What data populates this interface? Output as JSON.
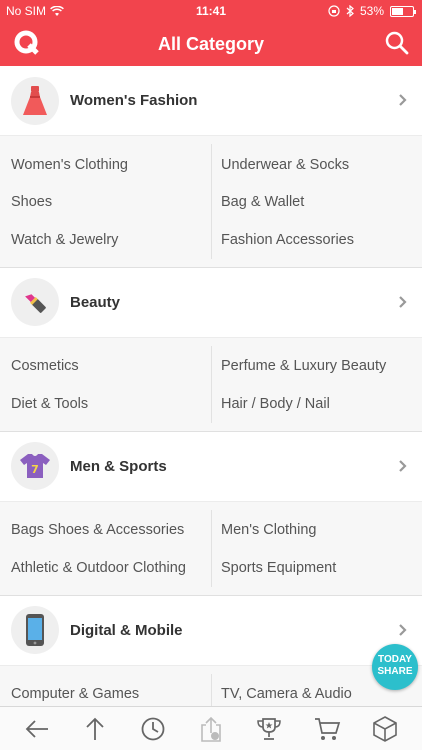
{
  "status_bar": {
    "carrier": "No SIM",
    "time": "11:41",
    "battery": "53%",
    "battery_level": 0.53
  },
  "header": {
    "title": "All Category"
  },
  "categories": [
    {
      "title": "Women's Fashion",
      "icon": "dress-icon",
      "subs": [
        [
          "Women's Clothing",
          "Underwear & Socks"
        ],
        [
          "Shoes",
          "Bag & Wallet"
        ],
        [
          "Watch & Jewelry",
          "Fashion Accessories"
        ]
      ]
    },
    {
      "title": "Beauty",
      "icon": "lipstick-icon",
      "subs": [
        [
          "Cosmetics",
          "Perfume & Luxury Beauty"
        ],
        [
          "Diet & Tools",
          "Hair / Body / Nail"
        ]
      ]
    },
    {
      "title": "Men & Sports",
      "icon": "jersey-icon",
      "subs": [
        [
          "Bags Shoes & Accessories",
          "Men's Clothing"
        ],
        [
          "Athletic & Outdoor Clothing",
          "Sports Equipment"
        ]
      ]
    },
    {
      "title": "Digital & Mobile",
      "icon": "smartphone-icon",
      "subs": [
        [
          "Computer & Games",
          "TV, Camera & Audio"
        ]
      ]
    }
  ],
  "floating": {
    "today_share_line1": "TODAY",
    "today_share_line2": "SHARE"
  },
  "bottom_bar": [
    "back-icon",
    "scroll-top-icon",
    "history-icon",
    "share-icon",
    "trophy-icon",
    "cart-icon",
    "box-icon"
  ],
  "colors": {
    "brand": "#f2444d",
    "accent": "#2cbfcc"
  }
}
